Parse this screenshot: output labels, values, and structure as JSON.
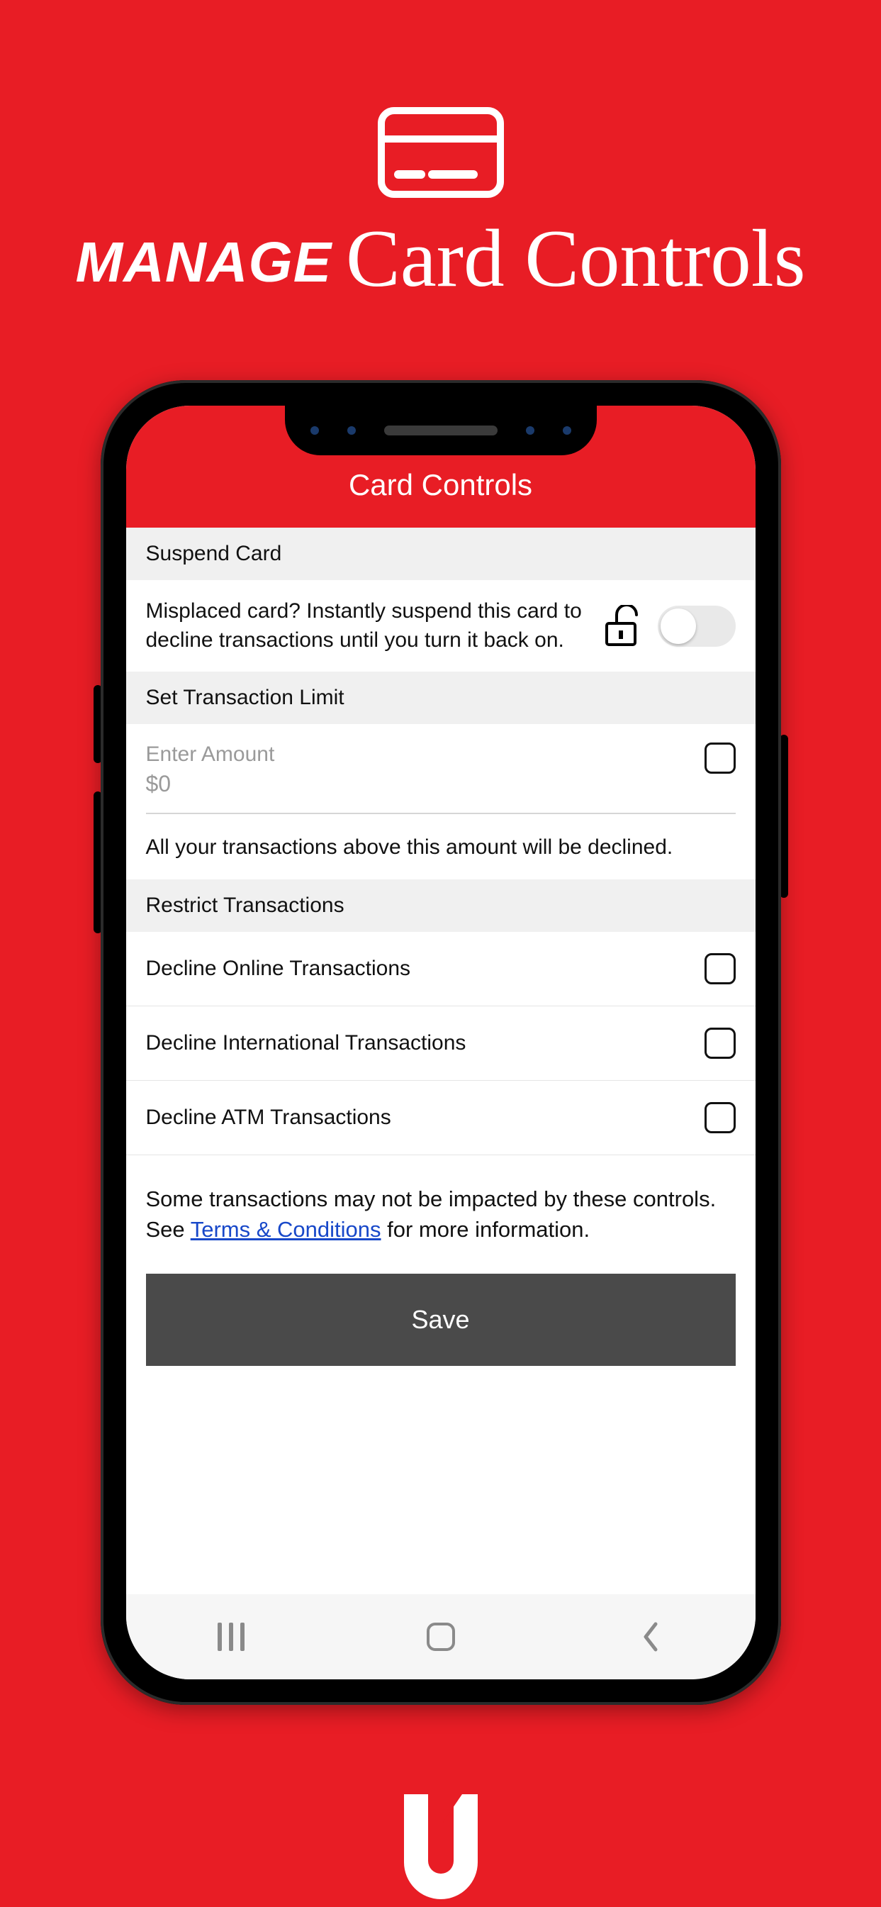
{
  "hero": {
    "title_word1": "MANAGE",
    "title_word2": "Card Controls"
  },
  "header": {
    "title": "Card Controls"
  },
  "sections": {
    "suspend": {
      "header": "Suspend Card",
      "description": "Misplaced card? Instantly suspend this card to decline transactions until you turn it back on.",
      "toggle_on": false
    },
    "limit": {
      "header": "Set Transaction Limit",
      "label": "Enter Amount",
      "value": "$0",
      "help": "All your transactions above this amount will be declined.",
      "checked": false
    },
    "restrict": {
      "header": "Restrict Transactions",
      "items": [
        {
          "label": "Decline Online Transactions",
          "checked": false
        },
        {
          "label": "Decline International Transactions",
          "checked": false
        },
        {
          "label": "Decline ATM Transactions",
          "checked": false
        }
      ]
    }
  },
  "disclosure": {
    "pre": "Some transactions may not be impacted by these controls. See ",
    "link": "Terms & Conditions",
    "post": " for more information."
  },
  "actions": {
    "save": "Save"
  }
}
